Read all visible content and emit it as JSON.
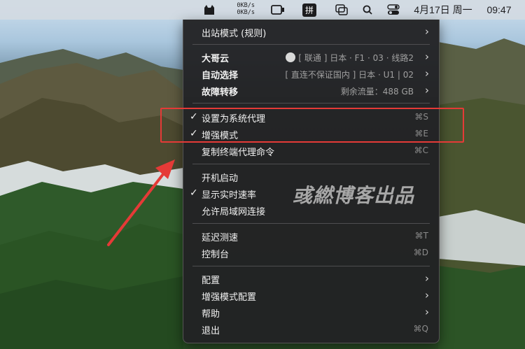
{
  "menubar": {
    "speed_up": "0KB/s",
    "speed_down": "0KB/s",
    "input_method": "拼",
    "date": "4月17日 周一",
    "time": "09:47"
  },
  "menu": {
    "outbound_mode": "出站模式 (规则)",
    "proxy_group_1": {
      "label": "大哥云",
      "detail": "[ 联通 ] 日本 · F1 · 03 · 线路2"
    },
    "proxy_group_2": {
      "label": "自动选择",
      "detail": "[ 直连不保证国内 ] 日本 · U1 | 02"
    },
    "proxy_group_3": {
      "label": "故障转移",
      "detail": "剩余流量：488 GB"
    },
    "set_system_proxy": {
      "label": "设置为系统代理",
      "shortcut": "⌘S",
      "checked": true
    },
    "enhanced_mode": {
      "label": "增强模式",
      "shortcut": "⌘E",
      "checked": true
    },
    "copy_terminal": {
      "label": "复制终端代理命令",
      "shortcut": "⌘C"
    },
    "launch_at_login": {
      "label": "开机启动"
    },
    "show_speed": {
      "label": "显示实时速率",
      "checked": true
    },
    "allow_lan": {
      "label": "允许局域网连接"
    },
    "latency_test": {
      "label": "延迟测速",
      "shortcut": "⌘T"
    },
    "console": {
      "label": "控制台",
      "shortcut": "⌘D"
    },
    "config": {
      "label": "配置"
    },
    "enhanced_config": {
      "label": "增强模式配置"
    },
    "help": {
      "label": "帮助"
    },
    "quit": {
      "label": "退出",
      "shortcut": "⌘Q"
    },
    "check_mark": "✓",
    "chevron": "›"
  },
  "watermark": "彧繎博客出品",
  "colors": {
    "highlight": "#e53a37",
    "menu_bg": "#222224"
  }
}
